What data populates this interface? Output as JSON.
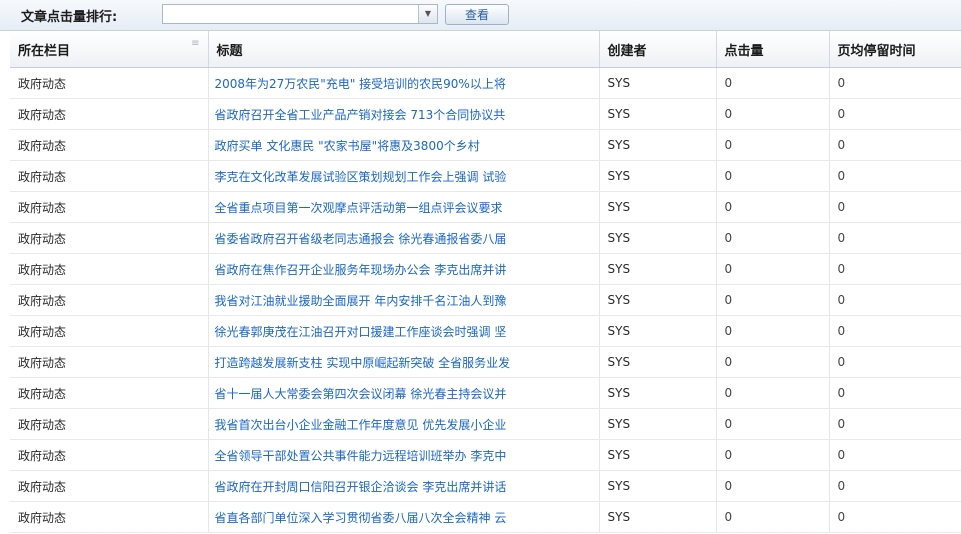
{
  "toolbar": {
    "label": "文章点击量排行:",
    "combo_value": "",
    "button_label": "查看"
  },
  "grid": {
    "columns": [
      "所在栏目",
      "标题",
      "创建者",
      "点击量",
      "页均停留时间"
    ],
    "rows": [
      {
        "column": "政府动态",
        "title": "2008年为27万农民\"充电\" 接受培训的农民90%以上将",
        "creator": "SYS",
        "clicks": "0",
        "avg_time": "0"
      },
      {
        "column": "政府动态",
        "title": "省政府召开全省工业产品产销对接会 713个合同协议共",
        "creator": "SYS",
        "clicks": "0",
        "avg_time": "0"
      },
      {
        "column": "政府动态",
        "title": "政府买单 文化惠民 \"农家书屋\"将惠及3800个乡村",
        "creator": "SYS",
        "clicks": "0",
        "avg_time": "0"
      },
      {
        "column": "政府动态",
        "title": "李克在文化改革发展试验区策划规划工作会上强调 试验",
        "creator": "SYS",
        "clicks": "0",
        "avg_time": "0"
      },
      {
        "column": "政府动态",
        "title": "全省重点项目第一次观摩点评活动第一组点评会议要求",
        "creator": "SYS",
        "clicks": "0",
        "avg_time": "0"
      },
      {
        "column": "政府动态",
        "title": "省委省政府召开省级老同志通报会 徐光春通报省委八届",
        "creator": "SYS",
        "clicks": "0",
        "avg_time": "0"
      },
      {
        "column": "政府动态",
        "title": "省政府在焦作召开企业服务年现场办公会 李克出席并讲",
        "creator": "SYS",
        "clicks": "0",
        "avg_time": "0"
      },
      {
        "column": "政府动态",
        "title": "我省对江油就业援助全面展开 年内安排千名江油人到豫",
        "creator": "SYS",
        "clicks": "0",
        "avg_time": "0"
      },
      {
        "column": "政府动态",
        "title": "徐光春郭庚茂在江油召开对口援建工作座谈会时强调 坚",
        "creator": "SYS",
        "clicks": "0",
        "avg_time": "0"
      },
      {
        "column": "政府动态",
        "title": "打造跨越发展新支柱 实现中原崛起新突破 全省服务业发",
        "creator": "SYS",
        "clicks": "0",
        "avg_time": "0"
      },
      {
        "column": "政府动态",
        "title": "省十一届人大常委会第四次会议闭幕 徐光春主持会议并",
        "creator": "SYS",
        "clicks": "0",
        "avg_time": "0"
      },
      {
        "column": "政府动态",
        "title": "我省首次出台小企业金融工作年度意见 优先发展小企业",
        "creator": "SYS",
        "clicks": "0",
        "avg_time": "0"
      },
      {
        "column": "政府动态",
        "title": "全省领导干部处置公共事件能力远程培训班举办 李克中",
        "creator": "SYS",
        "clicks": "0",
        "avg_time": "0"
      },
      {
        "column": "政府动态",
        "title": "省政府在开封周口信阳召开银企洽谈会 李克出席并讲话",
        "creator": "SYS",
        "clicks": "0",
        "avg_time": "0"
      },
      {
        "column": "政府动态",
        "title": "省直各部门单位深入学习贯彻省委八届八次全会精神 云",
        "creator": "SYS",
        "clicks": "0",
        "avg_time": "0"
      }
    ]
  },
  "icons": {
    "column_menu": "menu-lines-icon",
    "combo_trigger": "chevron-down-icon"
  },
  "colors": {
    "link": "#1a66c9",
    "button_text": "#2a5e9c"
  }
}
